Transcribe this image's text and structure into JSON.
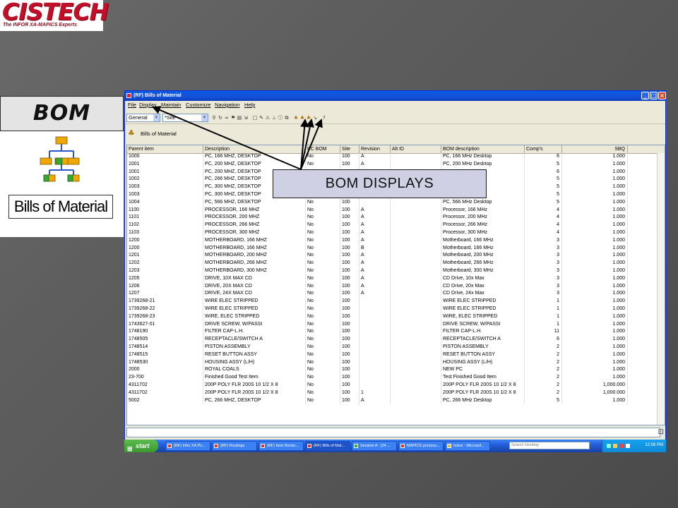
{
  "logo": {
    "word": "CISTECH",
    "tagline": "The INFOR XA-MAPICS Experts"
  },
  "left_panel": {
    "label": "BOM",
    "icon_caption": "Bills of Material"
  },
  "callout": {
    "label": "BOM DISPLAYS"
  },
  "window": {
    "title": "(RF) Bills of Material",
    "menu": [
      "File",
      "Display",
      "Maintain",
      "Customize",
      "Navigation",
      "Help"
    ],
    "toolbar": {
      "view_combo": "General",
      "filter_combo": "*Site"
    },
    "list_title": "Bills of Material"
  },
  "grid": {
    "columns": [
      "Parent item",
      "Description",
      "PC BOM",
      "Site",
      "Revision",
      "Alt ID",
      "BOM description",
      "Comp's",
      "SBQ"
    ],
    "rows": [
      [
        "1000",
        "PC, 166 MHZ, DESKTOP",
        "No",
        "100",
        "A",
        "",
        "PC, 166 MHz Desktop",
        "6",
        "1.000"
      ],
      [
        "1001",
        "PC, 200 MHZ, DESKTOP",
        "No",
        "100",
        "A",
        "",
        "PC, 200 MHz Desktop",
        "5",
        "1.000"
      ],
      [
        "1001",
        "PC, 200 MHZ, DESKTOP",
        "",
        "",
        "",
        "",
        "ktop",
        "6",
        "1.000"
      ],
      [
        "1002",
        "PC, 266 MHZ, DESKTOP",
        "",
        "",
        "",
        "",
        "ktop",
        "5",
        "1.000"
      ],
      [
        "1003",
        "PC, 300 MHZ, DESKTOP",
        "",
        "",
        "",
        "",
        "ktop",
        "5",
        "1.000"
      ],
      [
        "1003",
        "PC, 300 MHZ, DESKTOP",
        "",
        "",
        "",
        "",
        "ktop Copy",
        "5",
        "1.000"
      ],
      [
        "1004",
        "PC, 566 MHZ, DESKTOP",
        "No",
        "100",
        "",
        "",
        "PC, 566 MHz Desktop",
        "5",
        "1.000"
      ],
      [
        "1100",
        "PROCESSOR, 166 MHZ",
        "No",
        "100",
        "A",
        "",
        "Processor, 166 MHz",
        "4",
        "1.000"
      ],
      [
        "1101",
        "PROCESSOR, 200 MHZ",
        "No",
        "100",
        "A",
        "",
        "Processor, 200 MHz",
        "4",
        "1.000"
      ],
      [
        "1102",
        "PROCESSOR, 266 MHZ",
        "No",
        "100",
        "A",
        "",
        "Processor, 266 MHz",
        "4",
        "1.000"
      ],
      [
        "1103",
        "PROCESSOR, 300 MHZ",
        "No",
        "100",
        "A",
        "",
        "Processor, 300 MHz",
        "4",
        "1.000"
      ],
      [
        "1200",
        "MOTHERBOARD, 166 MHZ",
        "No",
        "100",
        "A",
        "",
        "Motherboard, 166 MHz",
        "3",
        "1.000"
      ],
      [
        "1200",
        "MOTHERBOARD, 166 MHZ",
        "No",
        "100",
        "B",
        "",
        "Motherboard, 166 MHz",
        "3",
        "1.000"
      ],
      [
        "1201",
        "MOTHERBOARD, 200 MHZ",
        "No",
        "100",
        "A",
        "",
        "Motherboard, 200 MHz",
        "3",
        "1.000"
      ],
      [
        "1202",
        "MOTHERBOARD, 266 MHZ",
        "No",
        "100",
        "A",
        "",
        "Motherboard, 266 MHz",
        "3",
        "1.000"
      ],
      [
        "1203",
        "MOTHERBOARD, 300 MHZ",
        "No",
        "100",
        "A",
        "",
        "Motherboard, 300 MHz",
        "3",
        "1.000"
      ],
      [
        "1205",
        "DRIVE, 10X MAX CD",
        "No",
        "100",
        "A",
        "",
        "CD Drive, 10x Max",
        "3",
        "1.000"
      ],
      [
        "1206",
        "DRIVE, 20X MAX CD",
        "No",
        "100",
        "A",
        "",
        "CD Drive, 20x Max",
        "3",
        "1.000"
      ],
      [
        "1207",
        "DRIVE, 24X MAX CD",
        "No",
        "100",
        "A",
        "",
        "CD Drive, 24x Max",
        "3",
        "1.000"
      ],
      [
        "1739268-21",
        "WIRE ELEC STRIPPED",
        "No",
        "100",
        "",
        "",
        "WIRE ELEC STRIPPED",
        "1",
        "1.000"
      ],
      [
        "1739268-22",
        "WIRE ELEC STRIPPED",
        "No",
        "100",
        "",
        "",
        "WIRE ELEC STRIPPED",
        "1",
        "1.000"
      ],
      [
        "1739268-23",
        "WIRE, ELEC STRIPPED",
        "No",
        "100",
        "",
        "",
        "WIRE, ELEC STRIPPED",
        "1",
        "1.000"
      ],
      [
        "1743627-01",
        "DRIVE SCREW, W/PASSI",
        "No",
        "100",
        "",
        "",
        "DRIVE SCREW, W/PASSI",
        "1",
        "1.000"
      ],
      [
        "1748190",
        "FILTER CAP-L.H.",
        "No",
        "100",
        "",
        "",
        "FILTER CAP-L.H.",
        "11",
        "1.000"
      ],
      [
        "1748505",
        "RECEPTACLE/SWITCH A",
        "No",
        "100",
        "",
        "",
        "RECEPTACLE/SWITCH A",
        "6",
        "1.000"
      ],
      [
        "1748514",
        "PISTON ASSEMBLY",
        "No",
        "100",
        "",
        "",
        "PISTON ASSEMBLY",
        "2",
        "1.000"
      ],
      [
        "1748515",
        "RESET BUTTON ASSY",
        "No",
        "100",
        "",
        "",
        "RESET BUTTON ASSY",
        "2",
        "1.000"
      ],
      [
        "1748530",
        "HOUSING ASSY (L/H)",
        "No",
        "100",
        "",
        "",
        "HOUSING ASSY (L/H)",
        "2",
        "1.000"
      ],
      [
        "2000",
        "ROYAL COALS",
        "No",
        "100",
        "",
        "",
        "NEW PC",
        "2",
        "1.000"
      ],
      [
        "23-700",
        "Finished Good Test Item",
        "No",
        "100",
        "",
        "",
        "Test Finished Good Item",
        "2",
        "1.000"
      ],
      [
        "4311702",
        "200P POLY FLR 200S 10 1/2 X 8",
        "No",
        "100",
        "",
        "",
        "200P POLY FLR 200S 10 1/2 X 8",
        "2",
        "1,000.000"
      ],
      [
        "4311702",
        "200P POLY FLR 200S 10 1/2 X 8",
        "No",
        "100",
        "1",
        "",
        "200P POLY FLR 200S 10 1/2 X 8",
        "2",
        "1,000.000"
      ],
      [
        "5002",
        "PC, 266 MHZ, DESKTOP",
        "No",
        "100",
        "A",
        "",
        "PC, 266 MHz Desktop",
        "5",
        "1.000"
      ]
    ]
  },
  "taskbar": {
    "start_label": "start",
    "tasks": [
      "(RF) Infor XA Po...",
      "(RF) Routings",
      "(RF) Item Revisi...",
      "(RF) Bills of Mat...",
      "Session A - [24 ...",
      "MAPICS process...",
      "Inbox - Microsof..."
    ],
    "search_placeholder": "Search Desktop",
    "clock": "12:06 PM"
  },
  "colors": {
    "logo_red": "#c2102a",
    "xp_blue": "#0a5ae8",
    "callout_fill": "#d0d0e4"
  }
}
